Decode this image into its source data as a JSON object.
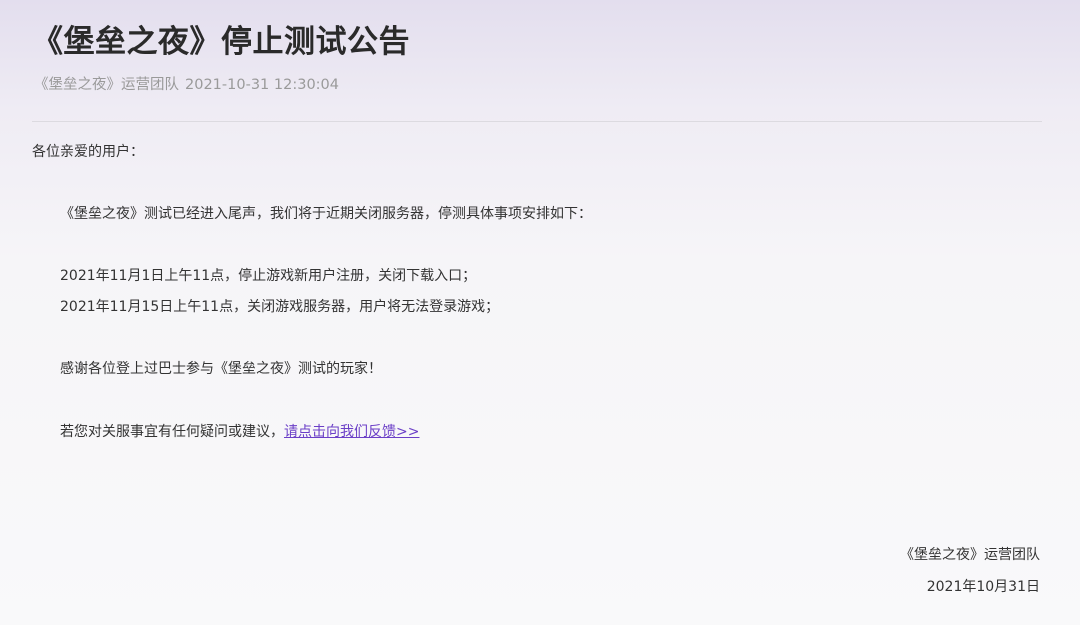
{
  "article": {
    "title": "《堡垒之夜》停止测试公告",
    "author": "《堡垒之夜》运营团队",
    "datetime": "2021-10-31 12:30:04"
  },
  "body": {
    "greeting": "各位亲爱的用户：",
    "intro": "《堡垒之夜》测试已经进入尾声，我们将于近期关闭服务器，停测具体事项安排如下：",
    "schedule": [
      "2021年11月1日上午11点，停止游戏新用户注册，关闭下载入口；",
      "2021年11月15日上午11点，关闭游戏服务器，用户将无法登录游戏；"
    ],
    "thanks": "感谢各位登上过巴士参与《堡垒之夜》测试的玩家！",
    "contact_text": "若您对关服事宜有任何疑问或建议，",
    "contact_link": "请点击向我们反馈>>"
  },
  "signature": {
    "team": "《堡垒之夜》运营团队",
    "date": "2021年10月31日"
  },
  "colors": {
    "link": "#6b3fc7",
    "meta": "#9a9a9a",
    "text": "#333333"
  }
}
